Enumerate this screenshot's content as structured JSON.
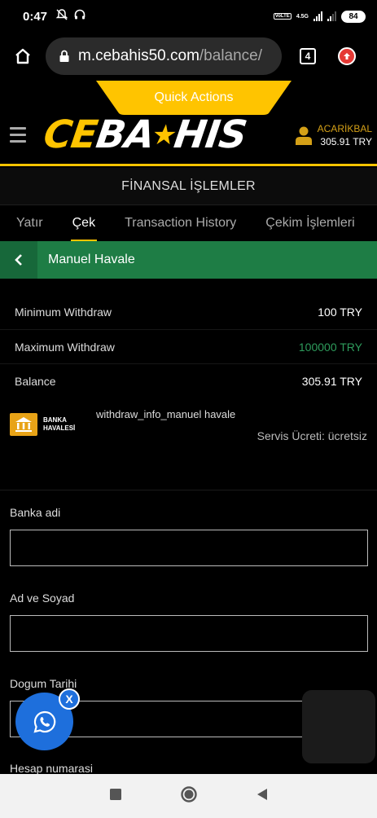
{
  "status": {
    "time": "0:47",
    "network": "4.5G",
    "volte": "VoLTE",
    "battery": "84"
  },
  "browser": {
    "url_host": "m.cebahis50.com",
    "url_path": "/balance/",
    "tab_count": "4"
  },
  "quick_actions": "Quick Actions",
  "header": {
    "logo_prefix": "CE",
    "logo_suffix_1": "BA",
    "logo_suffix_2": "HIS",
    "username": "ACARİKBAL",
    "balance": "305.91 TRY"
  },
  "page_title": "FİNANSAL İŞLEMLER",
  "tabs": [
    {
      "label": "Yatır"
    },
    {
      "label": "Çek"
    },
    {
      "label": "Transaction History"
    },
    {
      "label": "Çekim İşlemleri"
    }
  ],
  "section_title": "Manuel Havale",
  "info": {
    "min_label": "Minimum Withdraw",
    "min_value": "100 TRY",
    "max_label": "Maximum Withdraw",
    "max_value": "100000 TRY",
    "balance_label": "Balance",
    "balance_value": "305.91 TRY"
  },
  "method": {
    "label_line1": "BANKA",
    "label_line2": "HAVALESİ",
    "name": "withdraw_info_manuel havale",
    "fee": "Servis Ücreti: ücretsiz"
  },
  "form": {
    "bank_label": "Banka adi",
    "name_label": "Ad ve Soyad",
    "dob_label": "Dogum Tarihi",
    "account_label": "Hesap numarasi"
  },
  "whatsapp_close": "X",
  "colors": {
    "accent": "#ffc400",
    "green": "#1e7d45",
    "whatsapp_blue": "#1e6fdc"
  }
}
